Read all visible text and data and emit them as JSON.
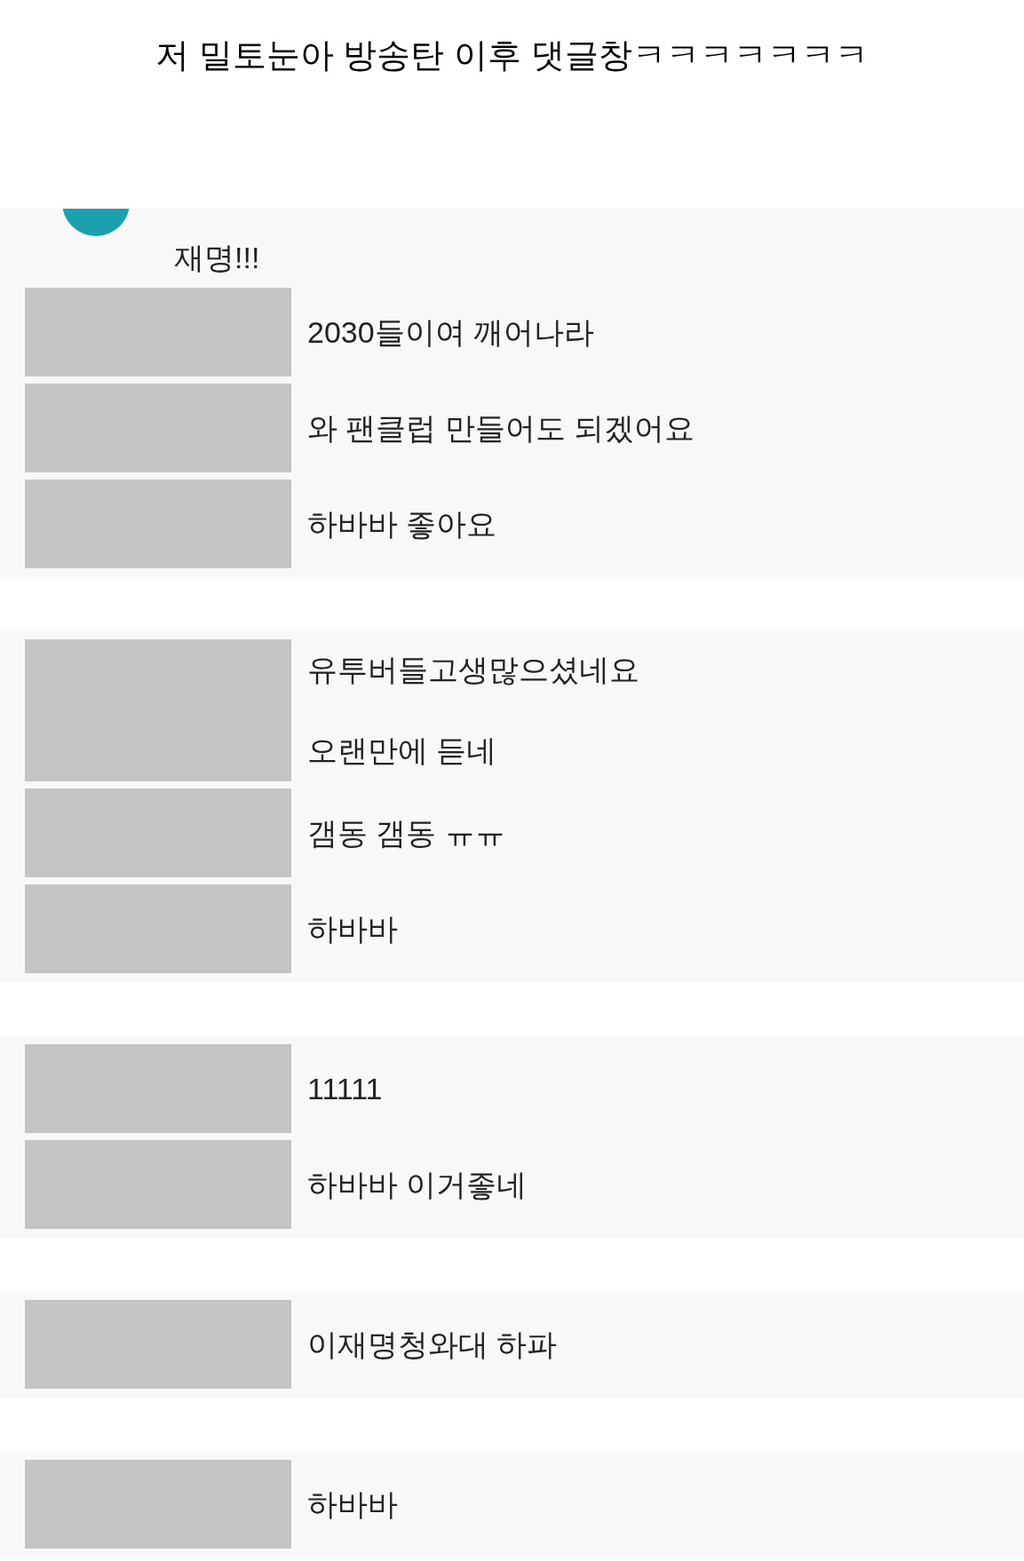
{
  "title": "저 밀토눈아 방송탄 이후 댓글창ㅋㅋㅋㅋㅋㅋㅋ",
  "panels": [
    {
      "comments": [
        {
          "kind": "continuation",
          "lines": [
            "재명!!!"
          ]
        },
        {
          "kind": "redacted",
          "lines": [
            "2030들이여 깨어나라"
          ]
        },
        {
          "kind": "redacted",
          "lines": [
            "와 팬클럽 만들어도 되겠어요"
          ]
        },
        {
          "kind": "redacted",
          "lines": [
            "하바바 좋아요"
          ]
        }
      ]
    },
    {
      "comments": [
        {
          "kind": "redacted",
          "lines": [
            "유투버들고생많으셨네요",
            "오랜만에 듣네"
          ]
        },
        {
          "kind": "redacted",
          "lines": [
            "갬동 갬동 ㅠㅠ"
          ]
        },
        {
          "kind": "redacted",
          "lines": [
            "하바바"
          ]
        }
      ]
    },
    {
      "comments": [
        {
          "kind": "redacted",
          "lines": [
            "11111"
          ]
        },
        {
          "kind": "redacted",
          "lines": [
            "하바바 이거좋네"
          ]
        }
      ]
    },
    {
      "comments": [
        {
          "kind": "redacted",
          "lines": [
            "이재명청와대 하파"
          ]
        }
      ]
    },
    {
      "comments": [
        {
          "kind": "redacted",
          "lines": [
            "하바바"
          ]
        }
      ]
    }
  ]
}
